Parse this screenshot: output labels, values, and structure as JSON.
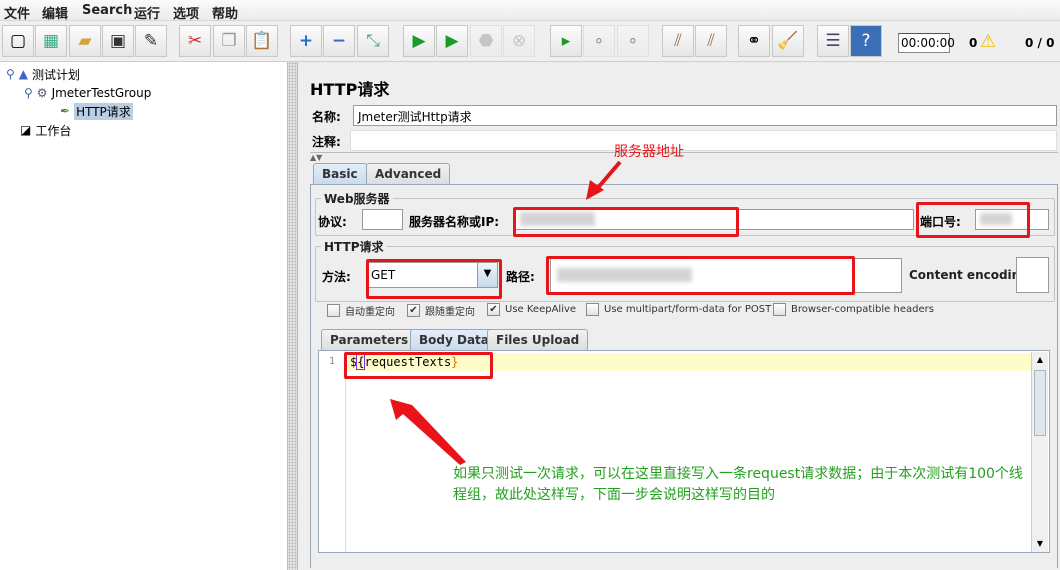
{
  "menu": [
    "文件",
    "编辑",
    "Search",
    "运行",
    "选项",
    "帮助"
  ],
  "toolbar": {
    "icons": [
      "new-icon",
      "templates-icon",
      "open-icon",
      "save-icon",
      "save-as-icon",
      "cut-icon",
      "copy-icon",
      "paste-icon",
      "expand-icon",
      "collapse-icon",
      "toggle-icon",
      "start-icon",
      "start-no-pause-icon",
      "stop-icon",
      "shutdown-icon",
      "remote-start-icon",
      "remote-stop-icon",
      "remote-shutdown-icon",
      "clear-icon",
      "clear-all-icon",
      "search-icon",
      "reset-search-icon",
      "function-helper-icon",
      "help-icon"
    ],
    "timer": "00:00:00",
    "warnings": "0",
    "threads": "0 / 0"
  },
  "tree": {
    "plan": "测试计划",
    "group": "JmeterTestGroup",
    "sampler": "HTTP请求",
    "workbench": "工作台"
  },
  "panel": {
    "title": "HTTP请求",
    "name_label": "名称:",
    "name_value": "Jmeter测试Http请求",
    "comment_label": "注释:",
    "comment_value": "",
    "tabs": [
      "Basic",
      "Advanced"
    ],
    "web_server": {
      "title": "Web服务器",
      "protocol_label": "协议:",
      "protocol_value": "",
      "server_label": "服务器名称或IP:",
      "port_label": "端口号:"
    },
    "http_request": {
      "title": "HTTP请求",
      "method_label": "方法:",
      "method_value": "GET",
      "path_label": "路径:",
      "encoding_label": "Content encoding:",
      "encoding_value": ""
    },
    "checkboxes": [
      {
        "label": "自动重定向",
        "checked": false
      },
      {
        "label": "跟随重定向",
        "checked": true
      },
      {
        "label": "Use KeepAlive",
        "checked": true
      },
      {
        "label": "Use multipart/form-data for POST",
        "checked": false
      },
      {
        "label": "Browser-compatible headers",
        "checked": false
      }
    ],
    "subtabs": [
      "Parameters",
      "Body Data",
      "Files Upload"
    ],
    "body": {
      "line_no": "1",
      "prefix": "$",
      "brace_open": "{",
      "var": "requestTexts",
      "brace_close": "}"
    }
  },
  "annotations": {
    "server_note": "服务器地址",
    "body_note": "如果只测试一次请求，可以在这里直接写入一条request请求数据；由于本次测试有100个线程组，故此处这样写，下面一步会说明这样写的目的",
    "red": "#e8141a",
    "green": "#22a11e"
  }
}
